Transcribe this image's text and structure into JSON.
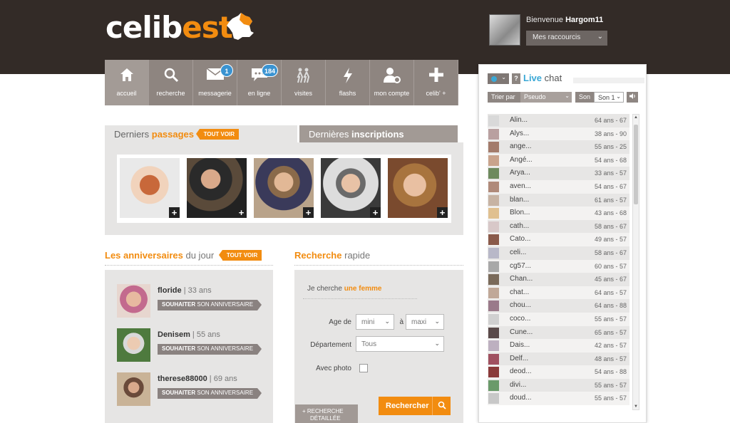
{
  "header": {
    "logo_part1": "celib",
    "logo_part2": "est",
    "welcome_prefix": "Bienvenue",
    "username": "Hargom11",
    "shortcuts_label": "Mes raccourcis"
  },
  "nav": {
    "items": [
      {
        "label": "accueil",
        "icon": "home-icon"
      },
      {
        "label": "recherche",
        "icon": "search-icon"
      },
      {
        "label": "messagerie",
        "icon": "envelope-icon",
        "badge": "1"
      },
      {
        "label": "en ligne",
        "icon": "chat-bubble-icon",
        "badge": "184"
      },
      {
        "label": "visites",
        "icon": "walking-people-icon"
      },
      {
        "label": "flashs",
        "icon": "lightning-icon"
      },
      {
        "label": "mon compte",
        "icon": "user-gear-icon"
      },
      {
        "label": "celib' +",
        "icon": "plus-icon"
      }
    ]
  },
  "tabs": {
    "passages_prefix": "Derniers",
    "passages_highlight": "passages",
    "see_all": "TOUT VOIR",
    "inscriptions_prefix": "Dernières",
    "inscriptions_bold": "inscriptions"
  },
  "birthdays": {
    "title_highlight": "Les anniversaires",
    "title_rest": "du jour",
    "see_all": "TOUT VOIR",
    "wish_bold": "SOUHAITER",
    "wish_rest": "SON ANNIVERSAIRE",
    "people": [
      {
        "name": "floride",
        "age": "33 ans"
      },
      {
        "name": "Denisem",
        "age": "55 ans"
      },
      {
        "name": "therese88000",
        "age": "69 ans"
      }
    ]
  },
  "quick_search": {
    "title_highlight": "Recherche",
    "title_rest": "rapide",
    "looking_prefix": "Je cherche",
    "looking_value": "une femme",
    "age_label": "Age de",
    "age_min": "mini",
    "age_to": "à",
    "age_max": "maxi",
    "dept_label": "Département",
    "dept_value": "Tous",
    "photo_label": "Avec photo",
    "detailed_label_1": "+ RECHERCHE",
    "detailed_label_2": "DÉTAILLÉE",
    "search_button": "Rechercher"
  },
  "chat": {
    "title_bold": "Live",
    "title_rest": "chat",
    "help": "?",
    "sort_label": "Trier par",
    "sort_value": "Pseudo",
    "sound_label": "Son",
    "sound_value": "Son 1",
    "users": [
      {
        "name": "Alin...",
        "age": "64 ans - 67"
      },
      {
        "name": "Alys...",
        "age": "38 ans - 90"
      },
      {
        "name": "ange...",
        "age": "55 ans - 25"
      },
      {
        "name": "Angé...",
        "age": "54 ans - 68"
      },
      {
        "name": "Arya...",
        "age": "33 ans - 57"
      },
      {
        "name": "aven...",
        "age": "54 ans - 67"
      },
      {
        "name": "blan...",
        "age": "61 ans - 57"
      },
      {
        "name": "Blon...",
        "age": "43 ans - 68"
      },
      {
        "name": "cath...",
        "age": "58 ans - 67"
      },
      {
        "name": "Cato...",
        "age": "49 ans - 57"
      },
      {
        "name": "celi...",
        "age": "58 ans - 67"
      },
      {
        "name": "cg57...",
        "age": "60 ans - 57"
      },
      {
        "name": "Chan...",
        "age": "45 ans - 67"
      },
      {
        "name": "chat...",
        "age": "64 ans - 57"
      },
      {
        "name": "chou...",
        "age": "64 ans - 88"
      },
      {
        "name": "coco...",
        "age": "55 ans - 57"
      },
      {
        "name": "Cune...",
        "age": "65 ans - 57"
      },
      {
        "name": "Dais...",
        "age": "42 ans - 57"
      },
      {
        "name": "Delf...",
        "age": "48 ans - 57"
      },
      {
        "name": "deod...",
        "age": "54 ans - 88"
      },
      {
        "name": "divi...",
        "age": "55 ans - 57"
      },
      {
        "name": "doud...",
        "age": "55 ans - 57"
      }
    ]
  },
  "colors": {
    "accent": "#f28c10",
    "header_bg": "#332b27",
    "live": "#3aa8d6",
    "badge": "#3a93d1"
  }
}
